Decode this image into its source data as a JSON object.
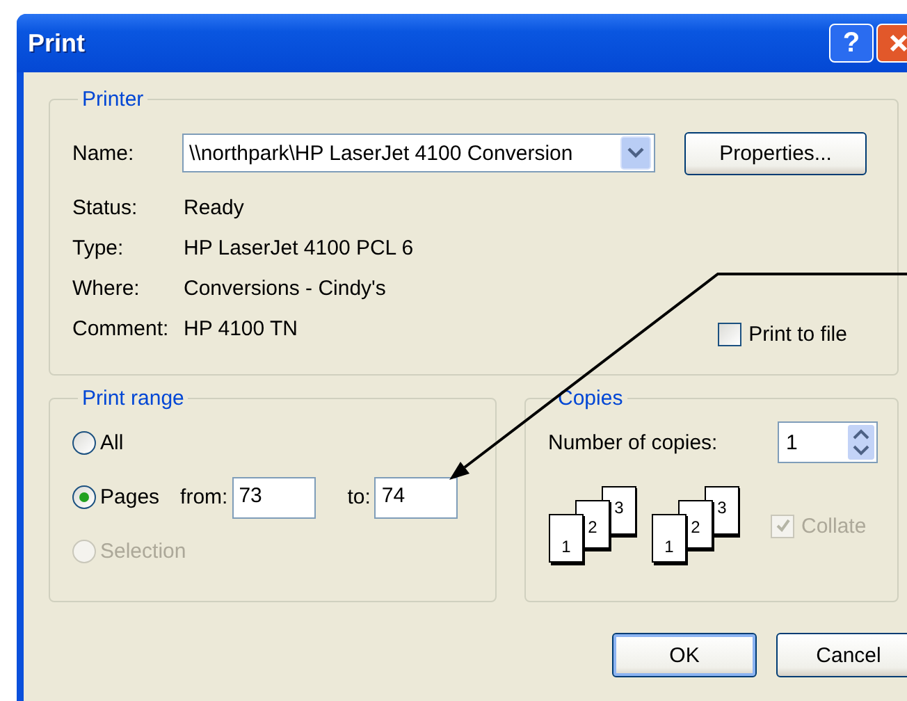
{
  "window": {
    "title": "Print",
    "help_button": "?"
  },
  "printer": {
    "title": "Printer",
    "name_label": "Name:",
    "name_value": "\\\\northpark\\HP LaserJet 4100 Conversion",
    "properties_button": "Properties...",
    "info": [
      {
        "label": "Status:",
        "value": "Ready"
      },
      {
        "label": "Type:",
        "value": "HP LaserJet 4100 PCL 6"
      },
      {
        "label": "Where:",
        "value": "Conversions - Cindy's"
      },
      {
        "label": "Comment:",
        "value": "HP 4100 TN"
      }
    ],
    "print_to_file": {
      "label": "Print to file",
      "checked": false
    }
  },
  "print_range": {
    "title": "Print range",
    "options": [
      {
        "label": "All",
        "selected": false,
        "disabled": false
      },
      {
        "label": "Pages",
        "selected": true,
        "disabled": false
      },
      {
        "label": "Selection",
        "selected": false,
        "disabled": true
      }
    ],
    "from_label": "from:",
    "from_value": "73",
    "to_label": "to:",
    "to_value": "74"
  },
  "copies": {
    "title": "Copies",
    "number_label": "Number of copies:",
    "number_value": "1",
    "collate_icons": [
      [
        "1",
        "2",
        "3"
      ],
      [
        "1",
        "2",
        "3"
      ]
    ],
    "collate": {
      "label": "Collate",
      "checked": true,
      "disabled": true
    }
  },
  "buttons": [
    {
      "label": "OK",
      "default": true
    },
    {
      "label": "Cancel",
      "default": false
    }
  ]
}
